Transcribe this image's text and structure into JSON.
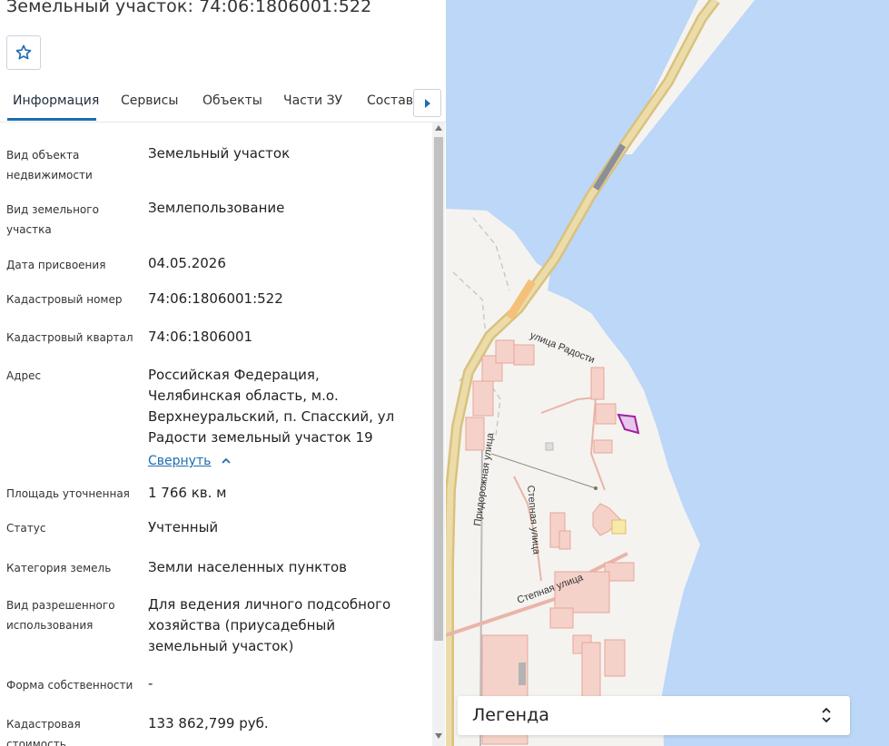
{
  "header": {
    "title": "Земельный участок: 74:06:1806001:522"
  },
  "tabs": [
    {
      "label": "Информация",
      "active": true
    },
    {
      "label": "Сервисы"
    },
    {
      "label": "Объекты"
    },
    {
      "label": "Части ЗУ"
    },
    {
      "label": "Состав"
    }
  ],
  "info": [
    {
      "label": "Вид объекта недвижимости",
      "value": "Земельный участок"
    },
    {
      "label": "Вид земельного участка",
      "value": "Землепользование"
    },
    {
      "label": "Дата присвоения",
      "value": "04.05.2026"
    },
    {
      "label": "Кадастровый номер",
      "value": "74:06:1806001:522"
    },
    {
      "label": "Кадастровый квартал",
      "value": "74:06:1806001"
    },
    {
      "label": "Адрес",
      "value": "Российская Федерация, Челябинская область, м.о. Верхнеуральский, п. Спасский, ул Радости земельный участок 19",
      "link": "Свернуть"
    },
    {
      "label": "Площадь уточненная",
      "value": "1 766 кв. м"
    },
    {
      "label": "Статус",
      "value": "Учтенный"
    },
    {
      "label": "Категория земель",
      "value": "Земли населенных пунктов"
    },
    {
      "label": "Вид разрешенного использования",
      "value": "Для ведения личного подсобного хозяйства (приусадебный земельный участок)"
    },
    {
      "label": "Форма собственности",
      "value": "-"
    },
    {
      "label": "Кадастровая стоимость",
      "value": "133 862,799 руб."
    }
  ],
  "map": {
    "streets": [
      "улица Радости",
      "Придорожная улица",
      "Степная улица",
      "Степная улица"
    ],
    "colors": {
      "water": "#bcd7f7",
      "land": "#f5f3f0",
      "road": "#e2cd94",
      "parcel": "#f2c2b8",
      "selected": "#a020a0"
    }
  },
  "legend": {
    "title": "Легенда"
  }
}
